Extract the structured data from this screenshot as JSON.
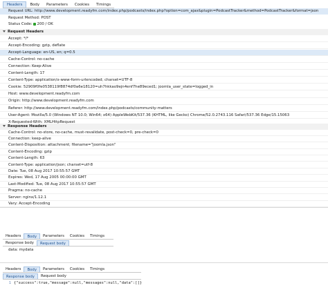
{
  "main_tabs": [
    "Headers",
    "Body",
    "Parameters",
    "Cookies",
    "Timings"
  ],
  "general": {
    "request_url": "Request URL: http://www.development.readyfm.com/index.php/podcasts/index.php?option=com_ajax&plugin=PodcastTracker&method=PodcastTracker&format=json",
    "request_method": "Request Method: POST",
    "status_label": "Status Code:",
    "status_value": "200 / OK"
  },
  "request_headers_title": "Request Headers",
  "request_headers": [
    "Accept: */*",
    "Accept-Encoding: gzip, deflate",
    "Accept-Language: en-US, en; q=0.5",
    "Cache-Control: no-cache",
    "Connection: Keep-Alive",
    "Content-Length: 17",
    "Content-Type: application/x-www-form-urlencoded; charset=UTF-8",
    "Cookie: 52909f0fe0538119f8874df0a6e18120=uh7hkkao9ejn4enf7he89eced1; joomla_user_state=logged_in",
    "Host: www.development.readyfm.com",
    "Origin: http://www.development.readyfm.com",
    "Referer: http://www.development.readyfm.com/index.php/podcasts/community-matters",
    "User-Agent: Mozilla/5.0 (Windows NT 10.0; Win64; x64) AppleWebKit/537.36 (KHTML, like Gecko) Chrome/52.0.2743.116 Safari/537.36 Edge/15.15063",
    "X-Requested-With: XMLHttpRequest"
  ],
  "response_headers_title": "Response Headers",
  "response_headers": [
    "Cache-Control: no-store, no-cache, must-revalidate, post-check=0, pre-check=0",
    "Connection: keep-alive",
    "Content-Disposition: attachment; filename=\"joomla.json\"",
    "Content-Encoding: gzip",
    "Content-Length: 63",
    "Content-Type: application/json; charset=utf-8",
    "Date: Tue, 08 Aug 2017 10:55:57 GMT",
    "Expires: Wed, 17 Aug 2005 00:00:00 GMT",
    "Last-Modified: Tue, 08 Aug 2017 10:55:57 GMT",
    "Pragma: no-cache",
    "Server: nginx/1.12.1",
    "Vary: Accept-Encoding"
  ],
  "body_panel_1": {
    "tabs": [
      "Headers",
      "Body",
      "Parameters",
      "Cookies",
      "Timings"
    ],
    "subtabs": [
      "Response body",
      "Request body"
    ],
    "content": "data: mydata"
  },
  "body_panel_2": {
    "tabs": [
      "Headers",
      "Body",
      "Parameters",
      "Cookies",
      "Timings"
    ],
    "subtabs": [
      "Response body",
      "Request body"
    ],
    "line_number": "1",
    "content": "{\"success\":true,\"message\":null,\"messages\":null,\"data\":[]}"
  },
  "colors": {
    "accent": "#1a4f8f",
    "highlight": "#dce9f7",
    "status_ok": "#2ca02c"
  }
}
